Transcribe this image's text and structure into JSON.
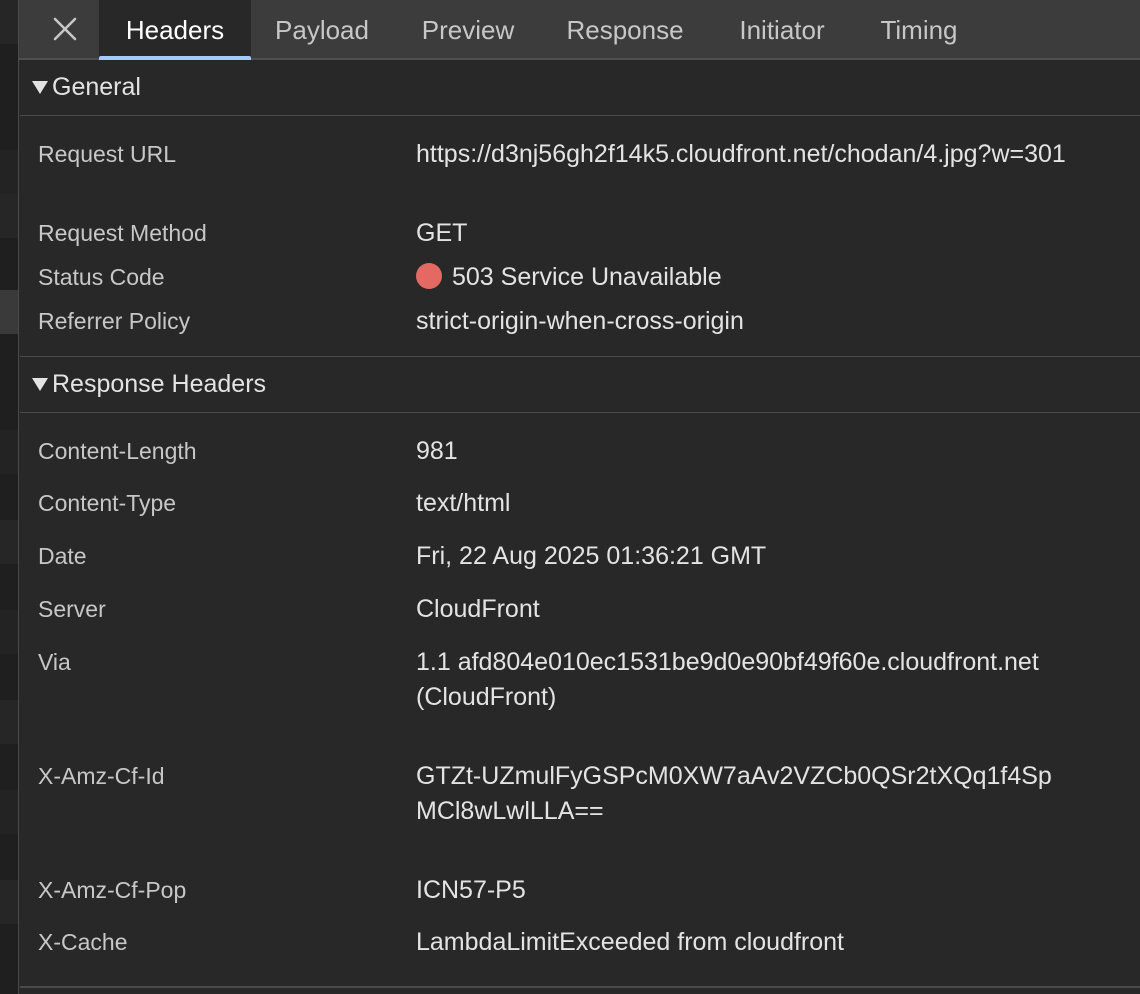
{
  "tabs": [
    {
      "label": "Headers",
      "active": true
    },
    {
      "label": "Payload",
      "active": false
    },
    {
      "label": "Preview",
      "active": false
    },
    {
      "label": "Response",
      "active": false
    },
    {
      "label": "Initiator",
      "active": false
    },
    {
      "label": "Timing",
      "active": false
    }
  ],
  "general": {
    "title": "General",
    "rows": [
      {
        "key": "Request URL",
        "value": "https://d3nj56gh2f14k5.cloudfront.net/chodan/4.jpg?w=301"
      },
      {
        "key": "Request Method",
        "value": "GET"
      },
      {
        "key": "Status Code",
        "value": "503 Service Unavailable",
        "status_color": "#e46962"
      },
      {
        "key": "Referrer Policy",
        "value": "strict-origin-when-cross-origin"
      }
    ]
  },
  "response_headers": {
    "title": "Response Headers",
    "rows": [
      {
        "key": "Content-Length",
        "value": "981"
      },
      {
        "key": "Content-Type",
        "value": "text/html"
      },
      {
        "key": "Date",
        "value": "Fri, 22 Aug 2025 01:36:21 GMT"
      },
      {
        "key": "Server",
        "value": "CloudFront"
      },
      {
        "key": "Via",
        "value": "1.1 afd804e010ec1531be9d0e90bf49f60e.cloudfront.net (CloudFront)"
      },
      {
        "key": "X-Amz-Cf-Id",
        "value": "GTZt-UZmulFyGSPcM0XW7aAv2VZCb0QSr2tXQq1f4SpMCl8wLwlLLA=="
      },
      {
        "key": "X-Amz-Cf-Pop",
        "value": "ICN57-P5"
      },
      {
        "key": "X-Cache",
        "value": "LambdaLimitExceeded from cloudfront"
      }
    ]
  },
  "colors": {
    "accent": "#a8c7fa",
    "error": "#e46962"
  }
}
